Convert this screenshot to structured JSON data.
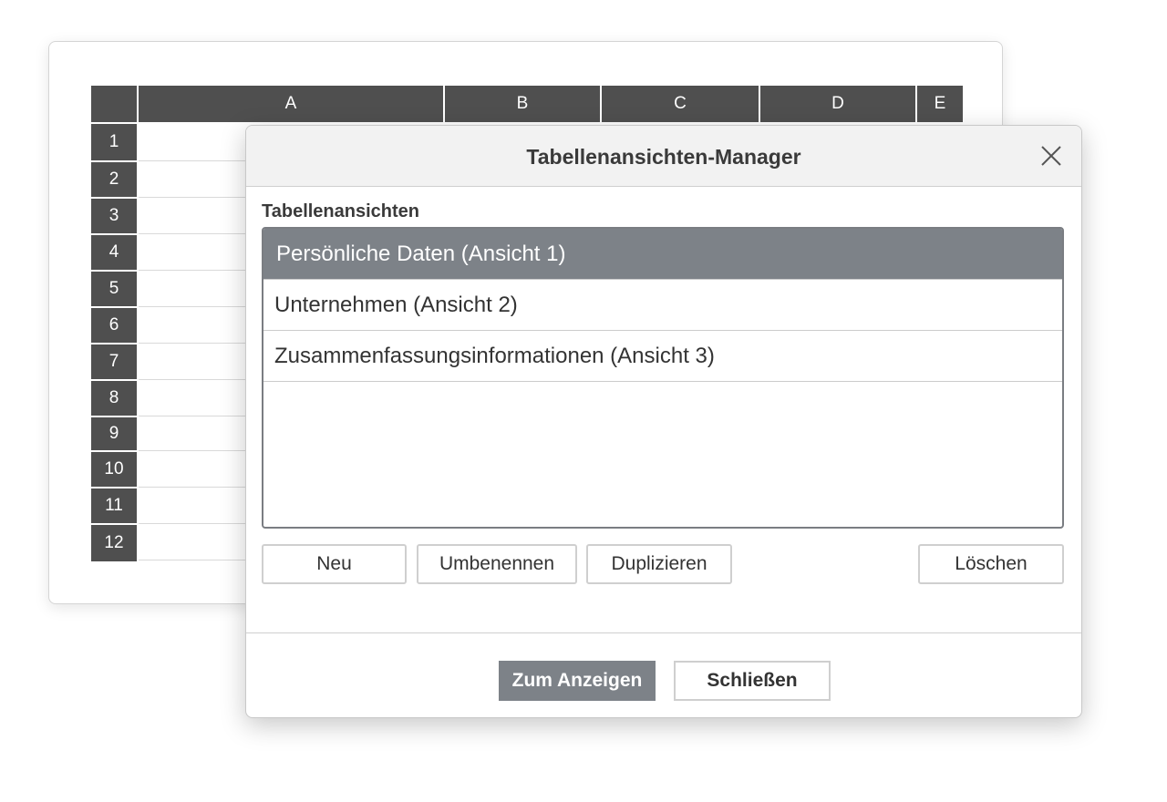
{
  "spreadsheet": {
    "columns": [
      "A",
      "B",
      "C",
      "D",
      "E"
    ],
    "rows": [
      "1",
      "2",
      "3",
      "4",
      "5",
      "6",
      "7",
      "8",
      "9",
      "10",
      "11",
      "12"
    ]
  },
  "dialog": {
    "title": "Tabellenansichten-Manager",
    "close_icon": "close-icon",
    "section_label": "Tabellenansichten",
    "views": [
      {
        "label": "Persönliche Daten (Ansicht 1)",
        "selected": true
      },
      {
        "label": "Unternehmen (Ansicht 2)",
        "selected": false
      },
      {
        "label": "Zusammenfassungsinformationen (Ansicht 3)",
        "selected": false
      }
    ],
    "actions": {
      "new": "Neu",
      "rename": "Umbenennen",
      "duplicate": "Duplizieren",
      "delete": "Löschen"
    },
    "footer": {
      "show": "Zum Anzeigen",
      "close": "Schließen"
    }
  },
  "colors": {
    "header_dark": "#4f4f4f",
    "selection": "#7d8288",
    "list_border": "#7a7d82"
  }
}
